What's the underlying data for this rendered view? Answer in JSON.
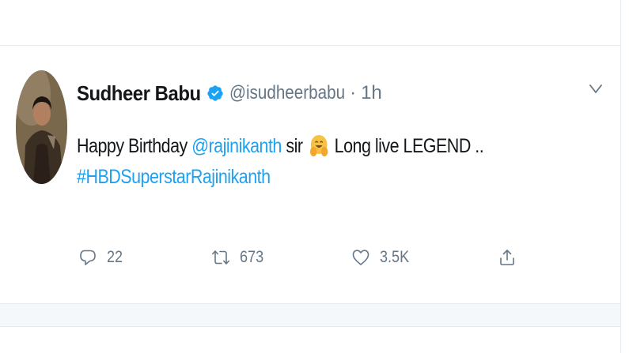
{
  "tweet": {
    "display_name": "Sudheer Babu",
    "handle": "@isudheerbabu",
    "separator": "·",
    "timestamp": "1h",
    "text": {
      "prefix": "Happy Birthday ",
      "mention": "@rajinikanth",
      "middle": " sir ",
      "emoji": "hugging-face-emoji",
      "suffix": " Long live LEGEND ..",
      "hashtag": "#HBDSuperstarRajinikanth"
    },
    "actions": {
      "reply_count": "22",
      "retweet_count": "673",
      "like_count": "3.5K"
    }
  },
  "colors": {
    "link": "#1da1f2",
    "verified": "#1da1f2",
    "secondary_text": "#657786",
    "primary_text": "#14171a",
    "divider": "#e6ecf0"
  },
  "icons": {
    "verified": "verified-badge-icon",
    "menu": "chevron-down-icon",
    "reply": "reply-icon",
    "retweet": "retweet-icon",
    "like": "heart-icon",
    "share": "share-icon"
  }
}
